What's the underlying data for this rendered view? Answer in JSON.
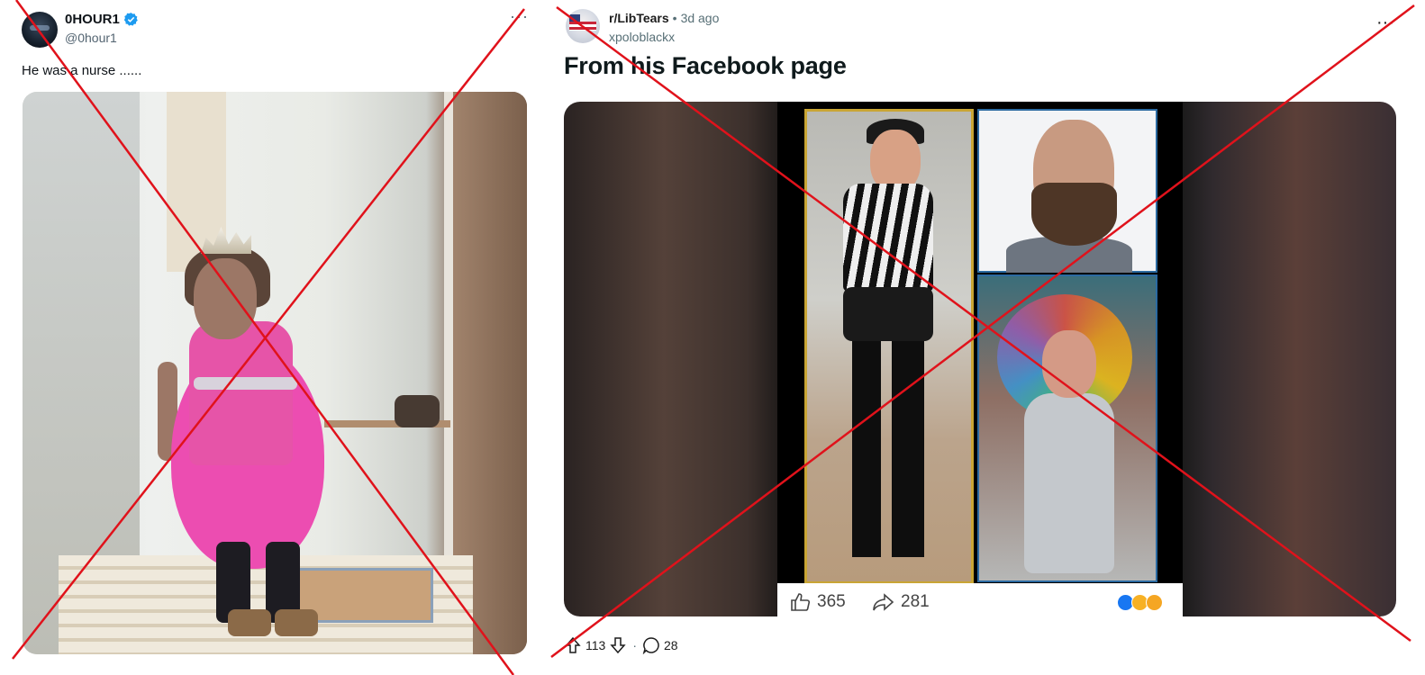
{
  "tweet": {
    "display_name": "0HOUR1",
    "handle": "@0hour1",
    "more_label": "···",
    "text": "He was a nurse ......",
    "verified_color": "#1d9bf0"
  },
  "reddit": {
    "subreddit": "r/LibTears",
    "age_separator": "•",
    "age": "3d ago",
    "username": "xpoloblackx",
    "more_label": "···",
    "title": "From his Facebook page",
    "embedded_post": {
      "likes": "365",
      "shares": "281"
    },
    "upvotes": "113",
    "comments": "28",
    "footer_separator": "·"
  },
  "overlay": {
    "stroke_color": "#e0121b"
  }
}
